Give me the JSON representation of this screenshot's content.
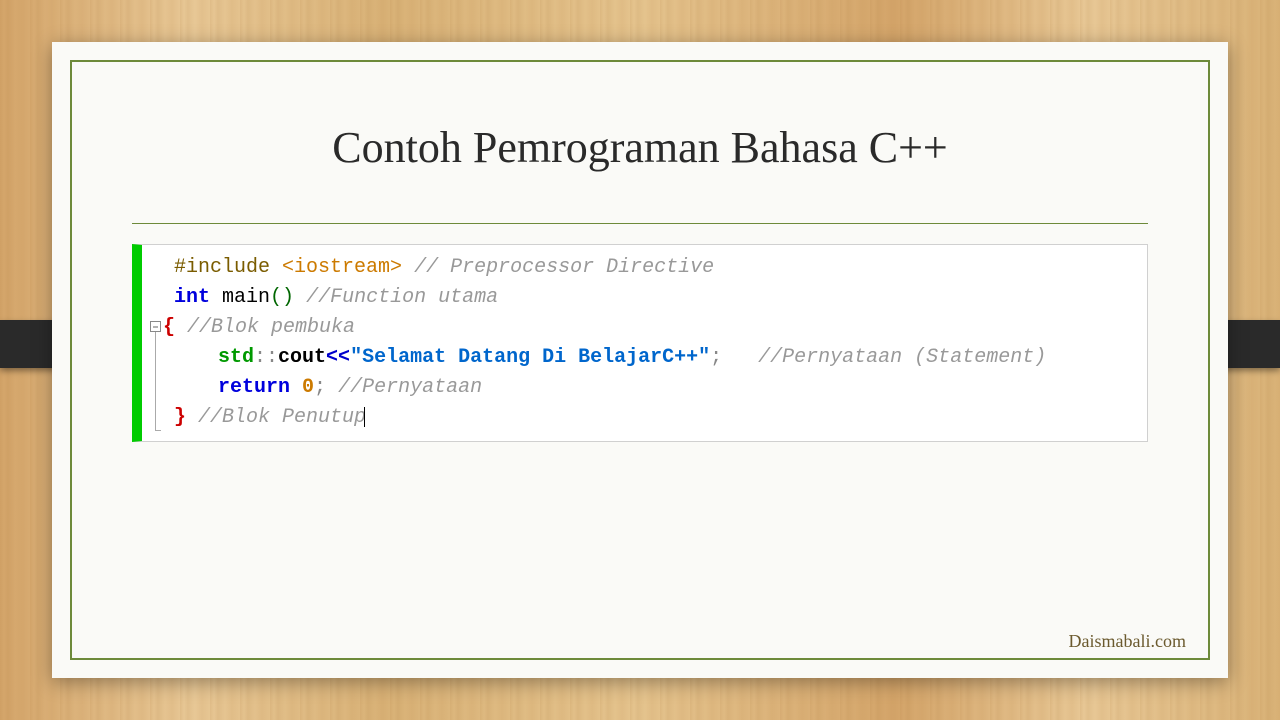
{
  "slide": {
    "title": "Contoh Pemrograman Bahasa C++",
    "watermark": "Daismabali.com"
  },
  "code": {
    "line1": {
      "preproc": "#include ",
      "header": "<iostream>",
      "space": " ",
      "comment": "// Preprocessor Directive"
    },
    "line2": {
      "keyword": "int ",
      "ident": "main",
      "paren": "()",
      "space": " ",
      "comment": "//Function utama"
    },
    "line3": {
      "brace": "{",
      "space": " ",
      "comment": "//Blok pembuka"
    },
    "line4": {
      "std": "std",
      "scope": "::",
      "member": "cout",
      "op": "<<",
      "string": "\"Selamat Datang Di BelajarC++\"",
      "semi": ";",
      "gap": "   ",
      "comment": "//Pernyataan (Statement)"
    },
    "line5": {
      "keyword": "return ",
      "num": "0",
      "semi": ";",
      "space": " ",
      "comment": "//Pernyataan"
    },
    "line6": {
      "brace": "}",
      "space": " ",
      "comment": "//Blok Penutup"
    }
  }
}
